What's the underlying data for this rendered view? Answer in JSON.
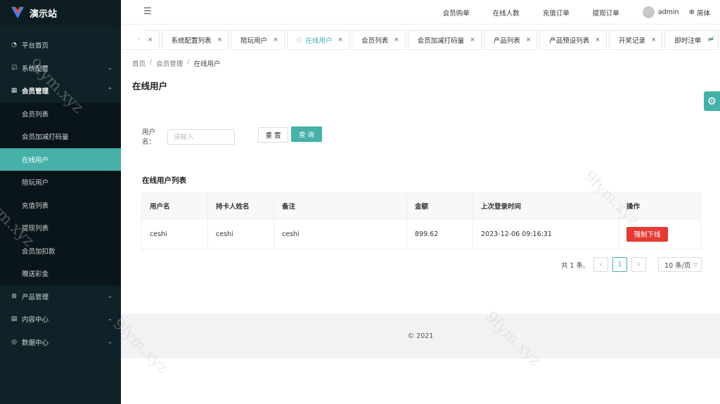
{
  "app": {
    "title": "演示站"
  },
  "sidebar": {
    "items": [
      {
        "label": "平台首页",
        "icon": "dashboard-icon"
      },
      {
        "label": "系统配置",
        "icon": "config-icon"
      },
      {
        "label": "会员管理",
        "icon": "table-icon"
      }
    ],
    "sub_items": [
      {
        "label": "会员列表"
      },
      {
        "label": "会员加减打码量"
      },
      {
        "label": "在线用户"
      },
      {
        "label": "陪玩用户"
      },
      {
        "label": "充值列表"
      },
      {
        "label": "提现列表"
      },
      {
        "label": "会员加扣款"
      },
      {
        "label": "赠送彩金"
      }
    ],
    "bottom_items": [
      {
        "label": "产品管理",
        "icon": "grid-icon"
      },
      {
        "label": "内容中心",
        "icon": "content-icon"
      },
      {
        "label": "数据中心",
        "icon": "data-icon"
      }
    ]
  },
  "topbar": {
    "links": [
      "会员购单",
      "在线人数",
      "充值订单",
      "提现订单"
    ],
    "user": "admin",
    "lang": "简体"
  },
  "tabs": [
    {
      "label": "系统配置列表"
    },
    {
      "label": "陪玩用户"
    },
    {
      "label": "在线用户"
    },
    {
      "label": "会员列表"
    },
    {
      "label": "会员加减打码量"
    },
    {
      "label": "产品列表"
    },
    {
      "label": "产品预设列表"
    },
    {
      "label": "开奖记录"
    },
    {
      "label": "即时注单"
    }
  ],
  "breadcrumb": [
    "首页",
    "会员管理",
    "在线用户"
  ],
  "page": {
    "title": "在线用户"
  },
  "search": {
    "label": "用户名：",
    "placeholder": "请输入",
    "reset": "重 置",
    "query": "查 询"
  },
  "list": {
    "title": "在线用户列表",
    "columns": [
      "用户名",
      "持卡人姓名",
      "备注",
      "金额",
      "上次登录时间",
      "操作"
    ],
    "rows": [
      {
        "username": "ceshi",
        "cardholder": "ceshi",
        "remark": "ceshi",
        "amount": "899.62",
        "last_login": "2023-12-06 09:16:31",
        "action": "强制下线"
      }
    ]
  },
  "pagination": {
    "total": "共 1 条,",
    "current": "1",
    "page_size": "10 条/页"
  },
  "footer": {
    "text": "© 2021"
  },
  "watermark": "9fym.xyz",
  "colors": {
    "accent": "#45b1a9",
    "danger": "#e53b35",
    "sidebar": "#0f2227"
  }
}
